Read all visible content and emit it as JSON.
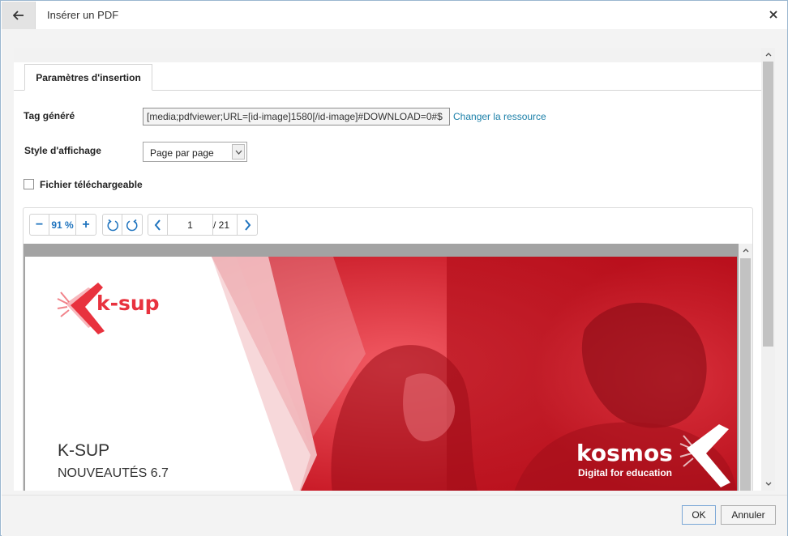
{
  "window": {
    "title": "Insérer un PDF",
    "back_icon": "arrow-left-icon",
    "close_icon": "close-icon"
  },
  "tabs": [
    {
      "label": "Paramètres d'insertion",
      "active": true
    }
  ],
  "form": {
    "tag_label": "Tag généré",
    "tag_value": "[media;pdfviewer;URL=[id-image]1580[/id-image]#DOWNLOAD=0#$",
    "change_link": "Changer la ressource",
    "style_label": "Style d'affichage",
    "style_value": "Page par page",
    "download_label": "Fichier téléchargeable",
    "download_checked": false
  },
  "viewer": {
    "zoom_out": "−",
    "zoom_level": "91 %",
    "zoom_in": "+",
    "current_page": "1",
    "page_count": "/ 21",
    "document": {
      "logo_text": "k-sup",
      "title": "K-SUP",
      "subtitle": "NOUVEAUTÉS 6.7",
      "brand": "kosmos",
      "brand_tagline": "Digital for education"
    }
  },
  "footer": {
    "ok_label": "OK",
    "cancel_label": "Annuler"
  },
  "colors": {
    "accent": "#1e73be",
    "link": "#1a7fa8",
    "brand_red": "#d11a2a"
  }
}
